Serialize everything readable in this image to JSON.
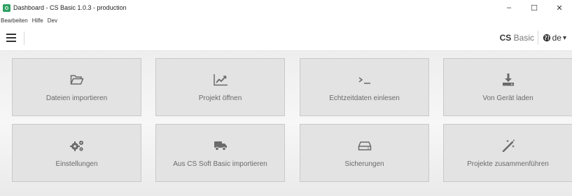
{
  "window": {
    "title": "Dashboard - CS Basic 1.0.3 - production",
    "controls": {
      "minimize": "–",
      "maximize": "☐",
      "close": "✕"
    }
  },
  "menu": [
    "Bearbeiten",
    "Hilfe",
    "Dev"
  ],
  "appbar": {
    "brand_bold": "CS",
    "brand_light": "Basic",
    "language": "de",
    "language_caret": "▾"
  },
  "tiles": [
    {
      "label": "Dateien importieren",
      "icon": "folder-open-icon"
    },
    {
      "label": "Projekt öffnen",
      "icon": "line-chart-icon"
    },
    {
      "label": "Echtzeitdaten einlesen",
      "icon": "terminal-icon"
    },
    {
      "label": "Von Gerät laden",
      "icon": "download-icon"
    },
    {
      "label": "Einstellungen",
      "icon": "gears-icon"
    },
    {
      "label": "Aus CS Soft Basic importieren",
      "icon": "truck-icon"
    },
    {
      "label": "Sicherungen",
      "icon": "hard-drive-icon"
    },
    {
      "label": "Projekte zusammenführen",
      "icon": "magic-wand-icon"
    }
  ],
  "colors": {
    "app_icon": "#2e9f63",
    "tile_bg": "#e3e3e3",
    "tile_border": "#c9c9c9",
    "tile_text": "#6a6a6a",
    "icon": "#6a6a6a"
  }
}
